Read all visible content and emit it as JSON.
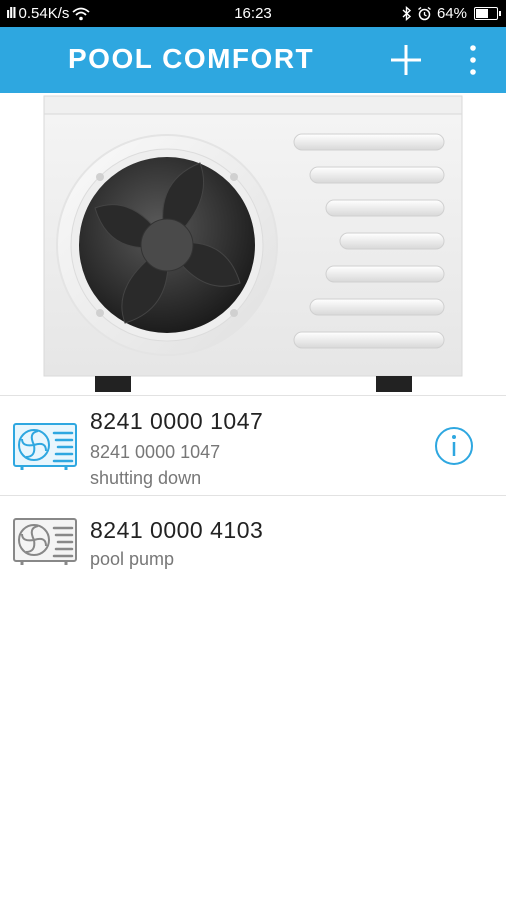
{
  "status_bar": {
    "signal": "ıll",
    "speed": "0.54K/s",
    "time": "16:23",
    "battery_percent": "64%",
    "battery_level": 0.64,
    "icons": [
      "signal-icon",
      "wifi-icon",
      "bluetooth-icon",
      "alarm-icon",
      "battery-icon"
    ]
  },
  "app_bar": {
    "title": "POOL COMFORT",
    "color": "#2ea7e0",
    "add_icon": "plus-icon",
    "menu_icon": "more-vert-icon"
  },
  "hero": {
    "image": "heat-pump-illustration"
  },
  "devices": [
    {
      "name": "8241 0000 1047",
      "line1": "8241 0000 1047",
      "line2": "shutting down",
      "icon": "heat-pump-icon",
      "icon_color": "#2ea7e0",
      "has_info": true
    },
    {
      "name": "8241 0000 4103",
      "line1": "pool pump",
      "icon": "heat-pump-icon",
      "icon_color": "#888888",
      "has_info": false
    }
  ]
}
